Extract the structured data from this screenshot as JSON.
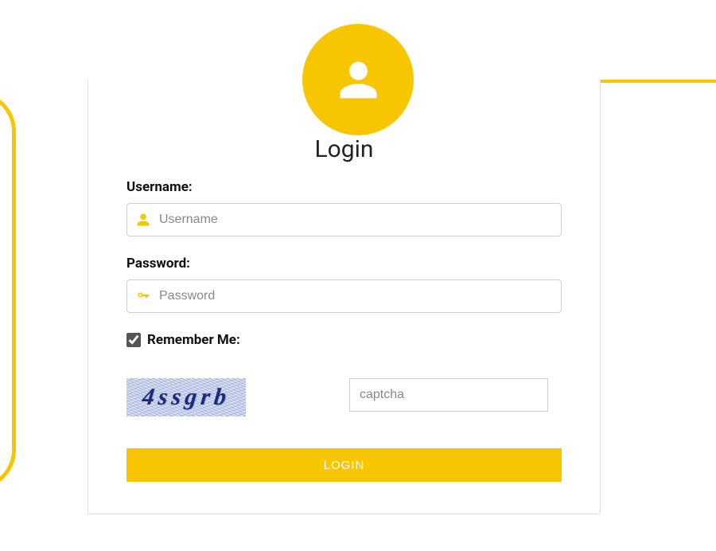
{
  "title": "Login",
  "username": {
    "label": "Username:",
    "placeholder": "Username",
    "value": ""
  },
  "password": {
    "label": "Password:",
    "placeholder": "Password",
    "value": ""
  },
  "remember": {
    "label": "Remember Me:",
    "checked": true
  },
  "captcha": {
    "image_text": "4ssgrb",
    "placeholder": "captcha",
    "value": ""
  },
  "submit": {
    "label": "LOGIN"
  },
  "colors": {
    "accent": "#f7c600"
  }
}
